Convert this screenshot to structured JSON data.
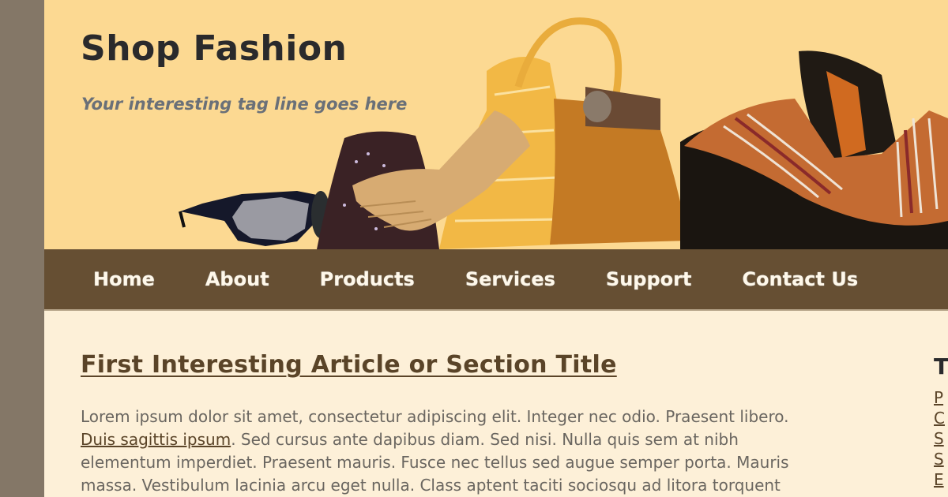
{
  "header": {
    "site_title": "Shop Fashion",
    "tagline": "Your interesting tag line goes here",
    "banner_items": [
      "sunglasses",
      "knit-hat",
      "leather-glove",
      "silk-scarf",
      "leather-handbag",
      "belt",
      "black-coat",
      "striped-scarf"
    ]
  },
  "nav": {
    "items": [
      {
        "label": "Home"
      },
      {
        "label": "About"
      },
      {
        "label": "Products"
      },
      {
        "label": "Services"
      },
      {
        "label": "Support"
      },
      {
        "label": "Contact Us"
      }
    ]
  },
  "article": {
    "title": "First Interesting Article or Section Title",
    "link_text": "Duis sagittis ipsum",
    "line1": "Lorem ipsum dolor sit amet, consectetur adipiscing elit. Integer nec odio. Praesent libero.",
    "line2_rest": ". Sed cursus ante dapibus diam. Sed nisi. Nulla quis sem at nibh",
    "line3": "elementum imperdiet. Praesent mauris. Fusce nec tellus sed augue semper porta. Mauris",
    "line4": "massa. Vestibulum lacinia arcu eget nulla. Class aptent taciti sociosqu ad litora torquent"
  },
  "sidebar": {
    "title": "T",
    "links": [
      "P",
      "C",
      "S",
      "S",
      "E"
    ]
  },
  "colors": {
    "outer_background": "#847767",
    "header_background": "#fcd992",
    "nav_background": "#664f33",
    "content_background": "#fdf0d8",
    "link_color": "#5a4428"
  }
}
